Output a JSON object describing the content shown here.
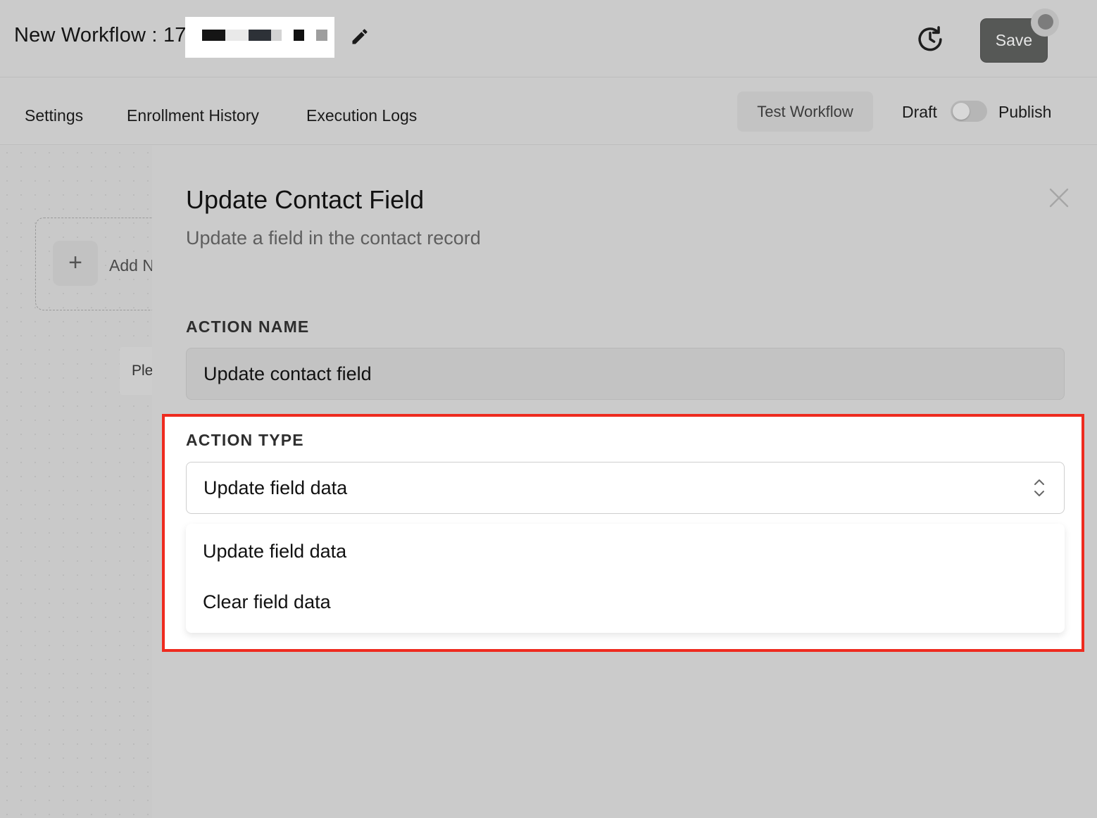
{
  "header": {
    "workflow_title": "New Workflow : 17",
    "save_label": "Save"
  },
  "subnav": {
    "tabs": [
      {
        "label": "Settings"
      },
      {
        "label": "Enrollment History"
      },
      {
        "label": "Execution Logs"
      }
    ],
    "test_workflow_label": "Test Workflow",
    "draft_label": "Draft",
    "publish_label": "Publish",
    "publish_toggle_on": false
  },
  "canvas": {
    "add_node_text": "Add N",
    "placeholder_text": "Ple"
  },
  "panel": {
    "title": "Update Contact Field",
    "subtitle": "Update a field in the contact record",
    "action_name_label": "ACTION NAME",
    "action_name_value": "Update contact field",
    "action_type_label": "ACTION TYPE",
    "action_type_value": "Update field data",
    "action_type_options": [
      {
        "label": "Update field data"
      },
      {
        "label": "Clear field data"
      }
    ]
  },
  "colors": {
    "highlight_border": "#ee2b1f",
    "save_button": "#565856",
    "background": "#cbcbcb"
  },
  "icons": {
    "edit": "pencil-icon",
    "history": "history-clock-icon",
    "close": "close-icon",
    "select": "chevron-up-down-icon",
    "add": "plus-icon"
  }
}
